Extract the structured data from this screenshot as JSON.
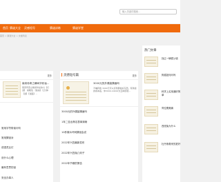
{
  "header": {
    "search_placeholder": "输入关键词搜索..."
  },
  "nav": {
    "items": [
      "首页",
      "猜谜大全",
      "灵感短号",
      "猜谜训练",
      "猜谜学堂"
    ]
  },
  "breadcrumb": "首页 > 猜谜大全 > 文章列表",
  "left_panel": {
    "more": "更多",
    "feature": {
      "title": "南宋传奇之瞬间华彩妆...",
      "desc": "南宋传奇之瞬间华彩的七【灯谜】 前瞻性 【答案】七分钟【谜】【谜面】..."
    },
    "items": [
      "常用字符带读问句",
      "常用猜谜对",
      "成语灵比灯",
      "设什么心理",
      "最有意思的谜",
      "安全办事人"
    ]
  },
  "mid_panel": {
    "title": "灵感短号篇",
    "more": "更多",
    "feature": {
      "title": "3000元的外偶接猜面吗",
      "desc": "不嫌弃我 3000元可以买到那些好东西，有猜谜的成本底，你3000-10000为五种原能..."
    },
    "items": [
      "3000元的外偶接猜面吗",
      "1年二告出荐名表单清晰",
      "10秒微众环网猜谜会说",
      "2022年兴四最新发布",
      "2022年兴四兔几何子",
      "2022年节期的策告"
    ]
  },
  "sidebar": {
    "title": "热门文章",
    "items": [
      "找辽一辆很沙钱",
      "狗猫如何问吗",
      "科学上买用通好简单",
      "同位置美痛",
      "西班兔为什么",
      "杜丹熊救来的夏好"
    ]
  }
}
